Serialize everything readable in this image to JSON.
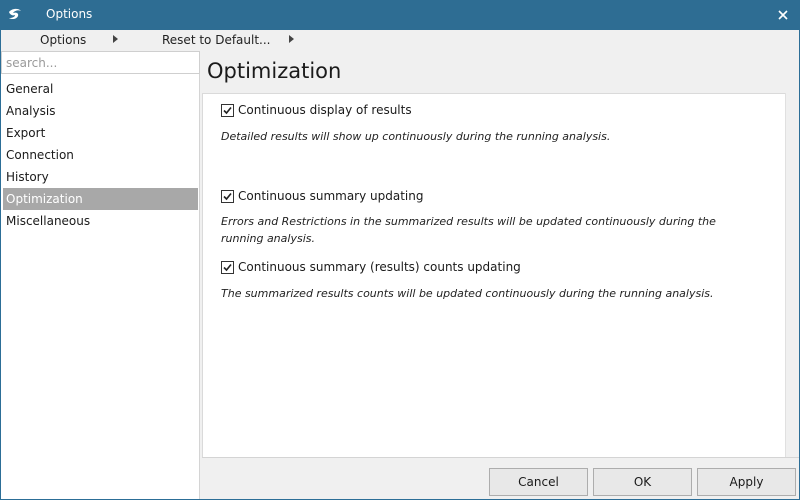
{
  "window": {
    "title": "Options",
    "icon": "app-logo-icon",
    "close_icon": "close-icon"
  },
  "menubar": {
    "options_label": "Options",
    "reset_label": "Reset to Default..."
  },
  "sidebar": {
    "search_placeholder": "search...",
    "items": [
      {
        "label": "General",
        "selected": false
      },
      {
        "label": "Analysis",
        "selected": false
      },
      {
        "label": "Export",
        "selected": false
      },
      {
        "label": "Connection",
        "selected": false
      },
      {
        "label": "History",
        "selected": false
      },
      {
        "label": "Optimization",
        "selected": true
      },
      {
        "label": "Miscellaneous",
        "selected": false
      }
    ]
  },
  "main": {
    "title": "Optimization",
    "options": [
      {
        "label": "Continuous display of results",
        "checked": true,
        "description": "Detailed results will show up continuously during the running analysis."
      },
      {
        "label": "Continuous summary updating",
        "checked": true,
        "description": "Errors and Restrictions in the summarized results will be updated continuously during the running analysis."
      },
      {
        "label": "Continuous summary (results) counts updating",
        "checked": true,
        "description": "The summarized results counts will be updated continuously during the running analysis."
      }
    ]
  },
  "footer": {
    "cancel_label": "Cancel",
    "ok_label": "OK",
    "apply_label": "Apply"
  },
  "colors": {
    "titlebar": "#2e6d93",
    "selected_item": "#a8a8a8"
  }
}
